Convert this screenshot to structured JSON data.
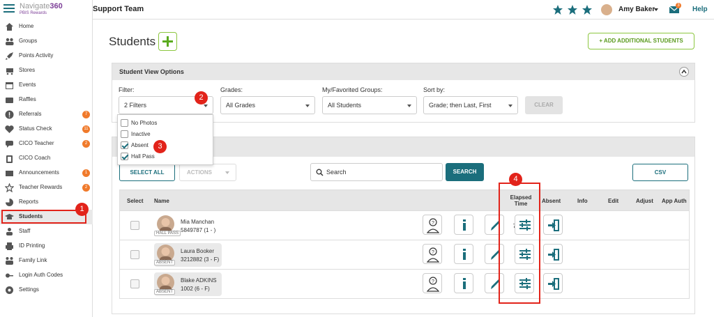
{
  "app": {
    "brand_prefix": "Navigate",
    "brand_suffix": "360",
    "brand_sub": "PBIS Rewards"
  },
  "topbar": {
    "team": "Support Team",
    "user": "Amy Baker",
    "mail_badge": "3",
    "help": "Help"
  },
  "sidebar": {
    "items": [
      {
        "label": "Home",
        "icon": "home-icon"
      },
      {
        "label": "Groups",
        "icon": "groups-icon"
      },
      {
        "label": "Points Activity",
        "icon": "rocket-icon"
      },
      {
        "label": "Stores",
        "icon": "cart-icon"
      },
      {
        "label": "Events",
        "icon": "calendar-icon"
      },
      {
        "label": "Raffles",
        "icon": "ticket-icon"
      },
      {
        "label": "Referrals",
        "icon": "alert-icon",
        "badge": "7"
      },
      {
        "label": "Status Check",
        "icon": "heart-icon",
        "badge": "11"
      },
      {
        "label": "CICO Teacher",
        "icon": "chat-icon",
        "badge": "2"
      },
      {
        "label": "CICO Coach",
        "icon": "clipboard-icon"
      },
      {
        "label": "Announcements",
        "icon": "mail-icon",
        "badge": "1"
      },
      {
        "label": "Teacher Rewards",
        "icon": "star-icon",
        "badge": "2"
      },
      {
        "label": "Reports",
        "icon": "pie-icon"
      },
      {
        "label": "Students",
        "icon": "graduation-cap-icon",
        "active": true
      },
      {
        "label": "Staff",
        "icon": "person-icon"
      },
      {
        "label": "ID Printing",
        "icon": "printer-icon"
      },
      {
        "label": "Family Link",
        "icon": "family-icon"
      },
      {
        "label": "Login Auth Codes",
        "icon": "key-icon"
      },
      {
        "label": "Settings",
        "icon": "gear-icon"
      }
    ]
  },
  "page": {
    "title": "Students",
    "add_label": "+ ADD ADDITIONAL STUDENTS"
  },
  "options": {
    "header": "Student View Options",
    "filter_label": "Filter:",
    "filter_value": "2 Filters",
    "grades_label": "Grades:",
    "grades_value": "All Grades",
    "groups_label": "My/Favorited Groups:",
    "groups_value": "All Students",
    "sort_label": "Sort by:",
    "sort_value": "Grade; then Last, First",
    "clear": "CLEAR",
    "filter_options": [
      {
        "label": "No Photos",
        "checked": false
      },
      {
        "label": "Inactive",
        "checked": false
      },
      {
        "label": "Absent",
        "checked": true
      },
      {
        "label": "Hall Pass",
        "checked": true
      }
    ]
  },
  "callouts": [
    "1",
    "2",
    "3",
    "4"
  ],
  "toolbar": {
    "select_all": "SELECT ALL",
    "actions": "ACTIONS",
    "search_placeholder": "Search",
    "search_btn": "SEARCH",
    "csv": "CSV"
  },
  "table": {
    "headers": {
      "select": "Select",
      "name": "Name",
      "elapsed1": "Elapsed",
      "elapsed2": "Time",
      "absent": "Absent",
      "info": "Info",
      "edit": "Edit",
      "adjust": "Adjust",
      "appauth": "App Auth"
    },
    "rows": [
      {
        "name": "Mia Manchan",
        "id": "5849787 (1 - )",
        "tag": "HALL PASS",
        "elapsed": "7:07 min"
      },
      {
        "name": "Laura Booker",
        "id": "3212882 (3 - F)",
        "tag": "ABSENT",
        "elapsed": ""
      },
      {
        "name": "Blake ADKINS",
        "id": "1002 (6 - F)",
        "tag": "ABSENT",
        "elapsed": ""
      }
    ]
  },
  "colors": {
    "accent": "#1b6e7c",
    "green": "#8cc63f",
    "badge": "#f07a2b",
    "callout": "#e2231a"
  }
}
